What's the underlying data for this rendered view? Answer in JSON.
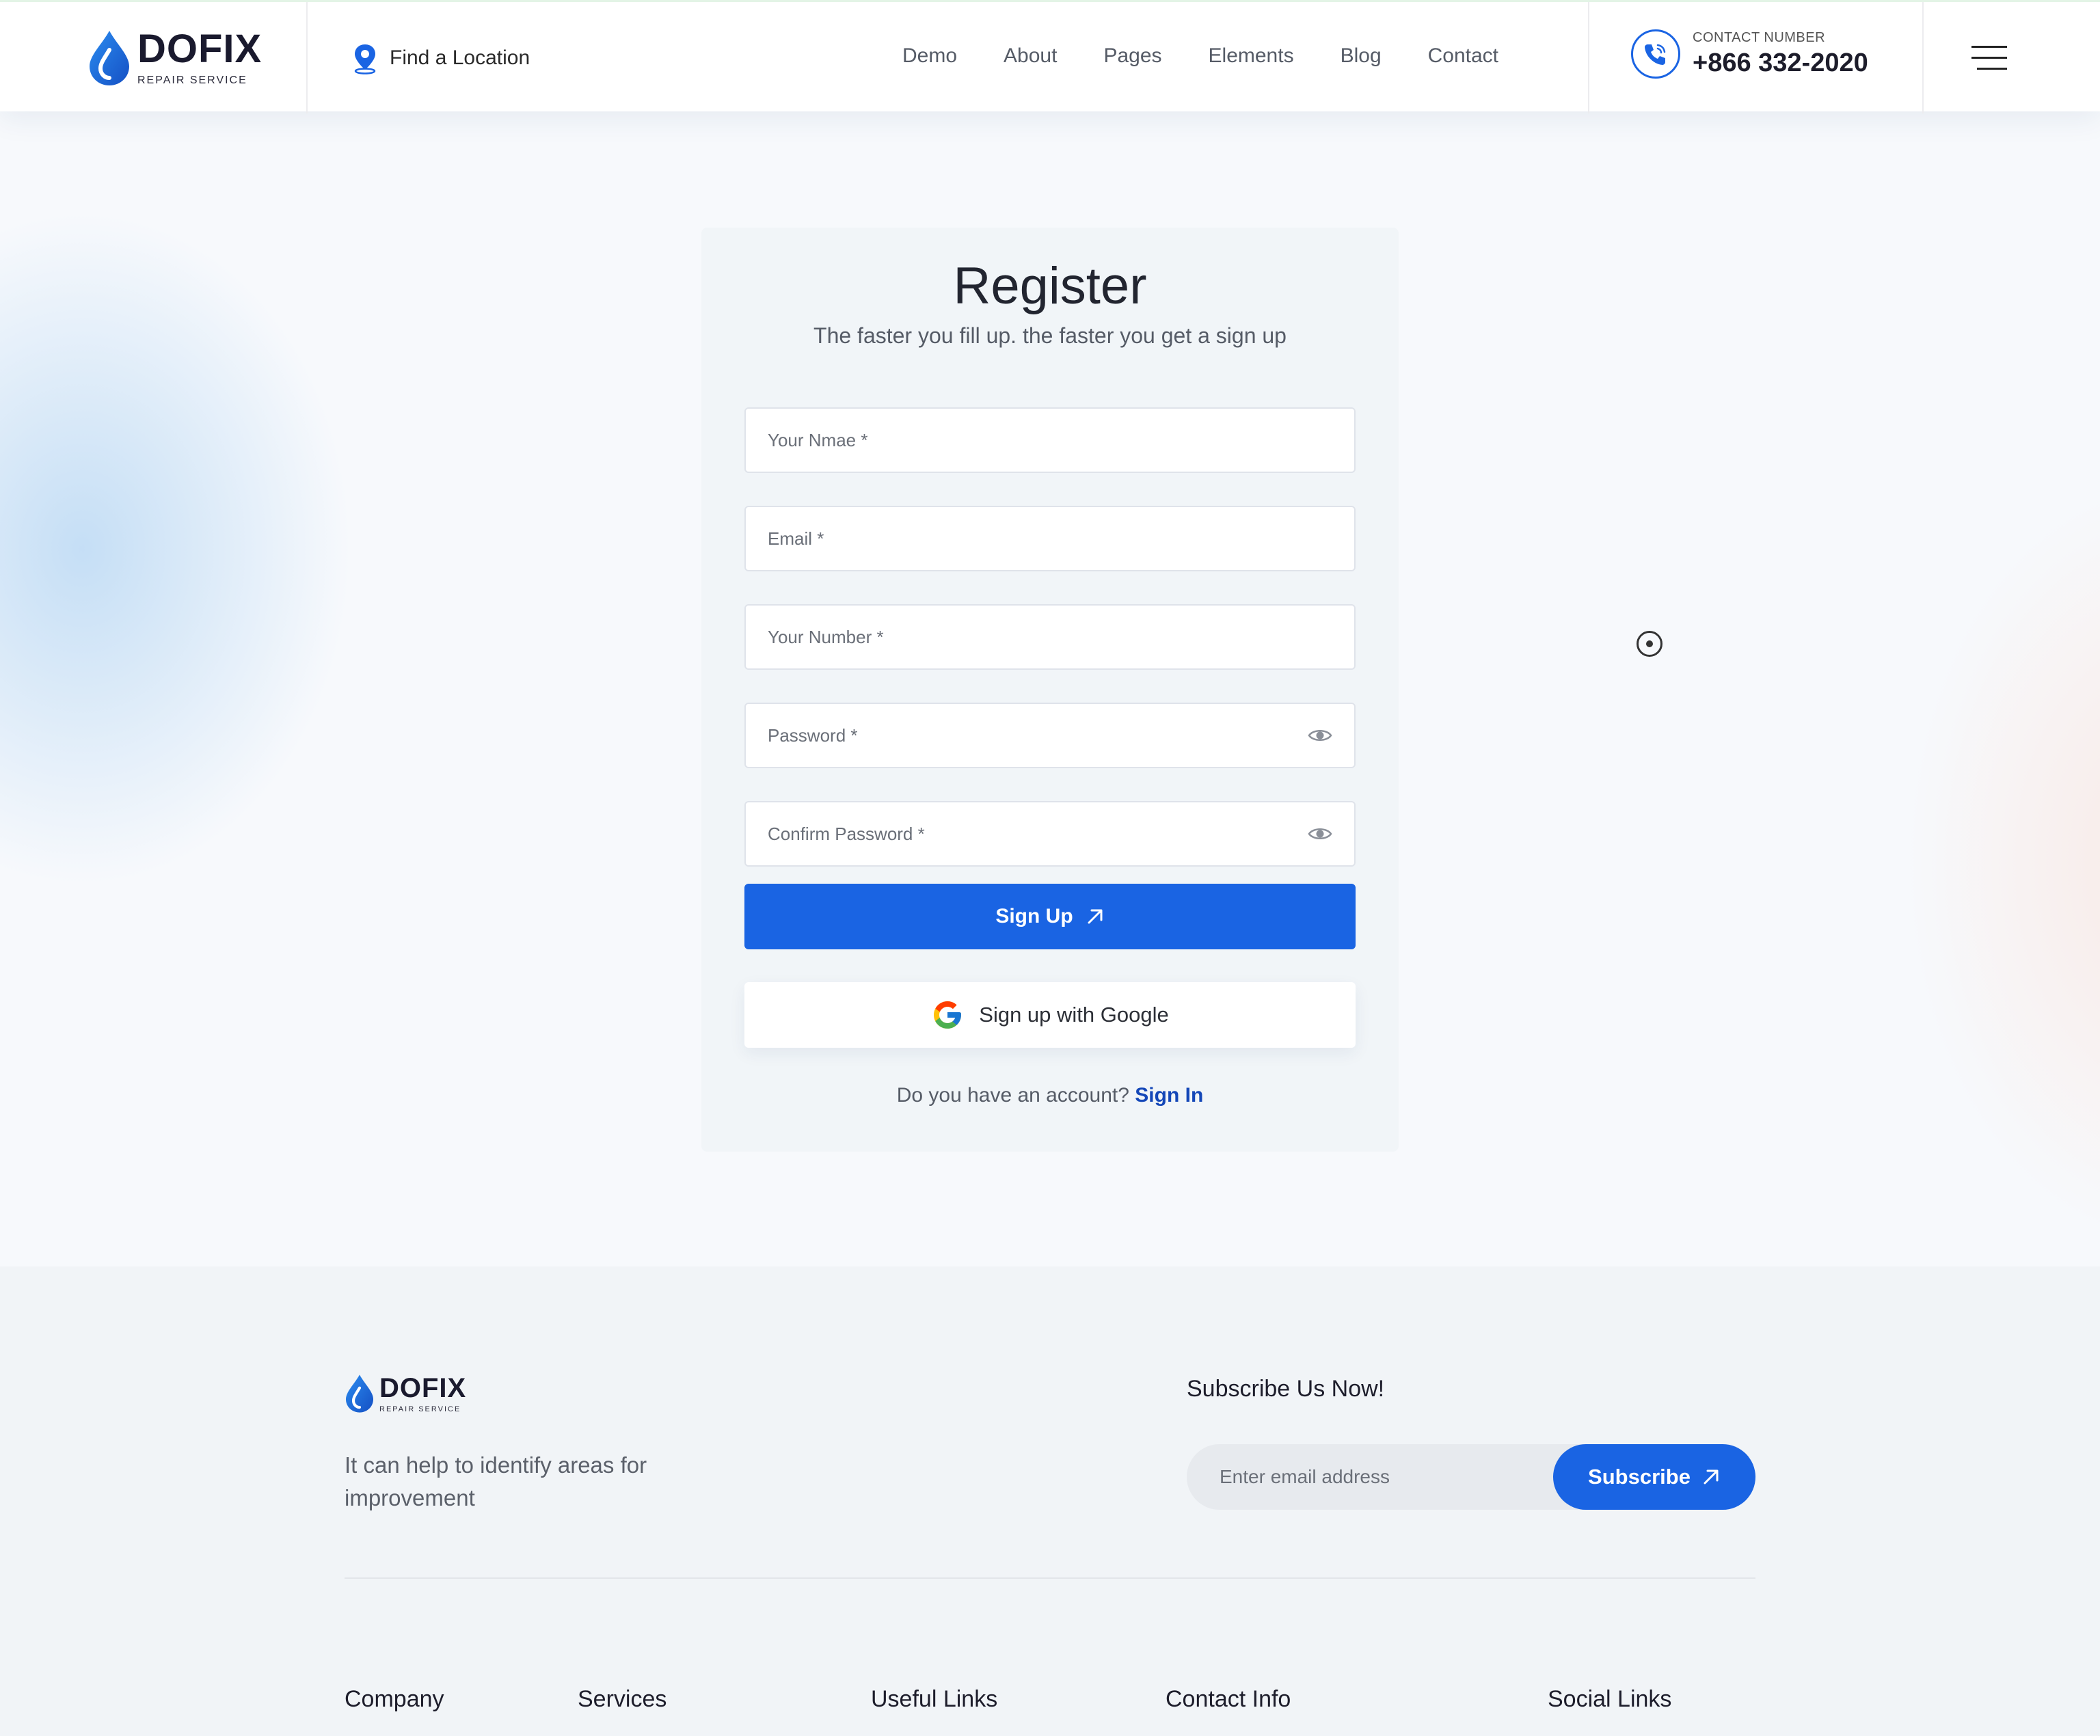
{
  "header": {
    "logo": {
      "name": "DOFIX",
      "tagline": "REPAIR SERVICE"
    },
    "location_label": "Find a Location",
    "nav": [
      "Demo",
      "About",
      "Pages",
      "Elements",
      "Blog",
      "Contact"
    ],
    "contact": {
      "label": "CONTACT NUMBER",
      "number": "+866 332-2020"
    }
  },
  "register": {
    "title": "Register",
    "subtitle": "The faster you fill up. the faster you get a sign up",
    "fields": {
      "name": "Your Nmae *",
      "email": "Email *",
      "number": "Your Number *",
      "password": "Password *",
      "confirm_password": "Confirm Password *"
    },
    "signup_label": "Sign Up",
    "google_label": "Sign up with Google",
    "account_prompt": "Do you have an account?",
    "signin_label": "Sign In"
  },
  "footer": {
    "logo": {
      "name": "DOFIX",
      "tagline": "REPAIR SERVICE"
    },
    "description": "It can help to identify areas for improvement",
    "subscribe_title": "Subscribe Us Now!",
    "email_placeholder": "Enter email address",
    "subscribe_label": "Subscribe",
    "columns": [
      "Company",
      "Services",
      "Useful Links",
      "Contact Info",
      "Social Links"
    ]
  },
  "colors": {
    "primary": "#1a64e3",
    "text_dark": "#1d1d2b",
    "text_muted": "#555b66",
    "link": "#1447b8"
  }
}
